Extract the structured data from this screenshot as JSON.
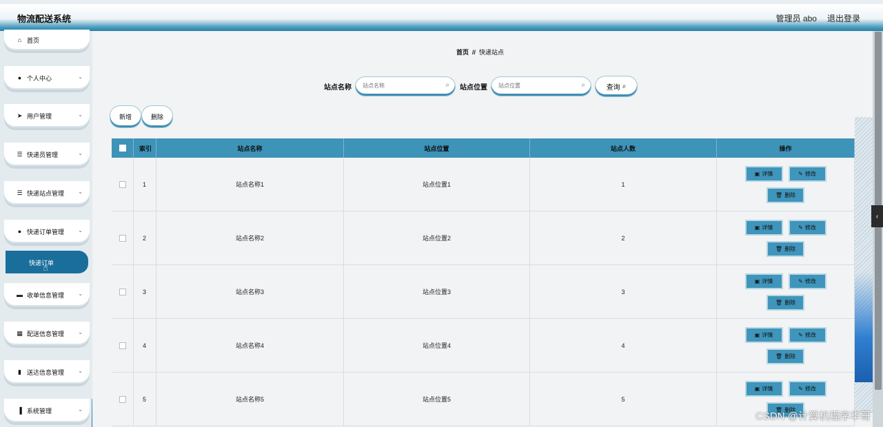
{
  "header": {
    "app_title": "物流配送系统",
    "user_label": "管理员 abo",
    "logout_label": "退出登录"
  },
  "sidebar": {
    "items": [
      {
        "label": "首页",
        "icon": "home-icon",
        "glyph": "🏠",
        "expandable": false
      },
      {
        "label": "个人中心",
        "icon": "user-icon",
        "glyph": "👤",
        "expandable": true
      },
      {
        "label": "用户管理",
        "icon": "send-icon",
        "glyph": "➤",
        "expandable": true
      },
      {
        "label": "快递员管理",
        "icon": "list-icon",
        "glyph": "☰",
        "expandable": true
      },
      {
        "label": "快递站点管理",
        "icon": "list-icon",
        "glyph": "☰",
        "expandable": true
      },
      {
        "label": "快递订单管理",
        "icon": "user-icon",
        "glyph": "👤",
        "expandable": true
      },
      {
        "label": "收单信息管理",
        "icon": "monitor-icon",
        "glyph": "▬",
        "expandable": true
      },
      {
        "label": "配送信息管理",
        "icon": "grid-icon",
        "glyph": "▦",
        "expandable": true
      },
      {
        "label": "送达信息管理",
        "icon": "clipboard-icon",
        "glyph": "▮",
        "expandable": true
      },
      {
        "label": "系统管理",
        "icon": "bar-chart-icon",
        "glyph": "▐",
        "expandable": true
      }
    ],
    "active_sub_item": "快递订单"
  },
  "breadcrumb": {
    "home": "首页",
    "separator": "//",
    "current": "快递站点"
  },
  "search": {
    "name_label": "站点名称",
    "name_placeholder": "站点名称",
    "location_label": "站点位置",
    "location_placeholder": "站点位置",
    "query_label": "查询"
  },
  "toolbar": {
    "add_label": "新增",
    "delete_label": "删除"
  },
  "table": {
    "columns": [
      "索引",
      "站点名称",
      "站点位置",
      "站点人数",
      "操作"
    ],
    "rows": [
      {
        "index": "1",
        "name": "站点名称1",
        "location": "站点位置1",
        "count": "1"
      },
      {
        "index": "2",
        "name": "站点名称2",
        "location": "站点位置2",
        "count": "2"
      },
      {
        "index": "3",
        "name": "站点名称3",
        "location": "站点位置3",
        "count": "3"
      },
      {
        "index": "4",
        "name": "站点名称4",
        "location": "站点位置4",
        "count": "4"
      },
      {
        "index": "5",
        "name": "站点名称5",
        "location": "站点位置5",
        "count": "5"
      }
    ],
    "actions": {
      "detail": "详情",
      "edit": "修改",
      "delete": "删除"
    }
  },
  "watermark": "CSDN @计算机程序华哥",
  "colors": {
    "accent": "#3d93b8",
    "active_nav": "#1a6e9c",
    "header_bottom": "#2a7fa7"
  }
}
